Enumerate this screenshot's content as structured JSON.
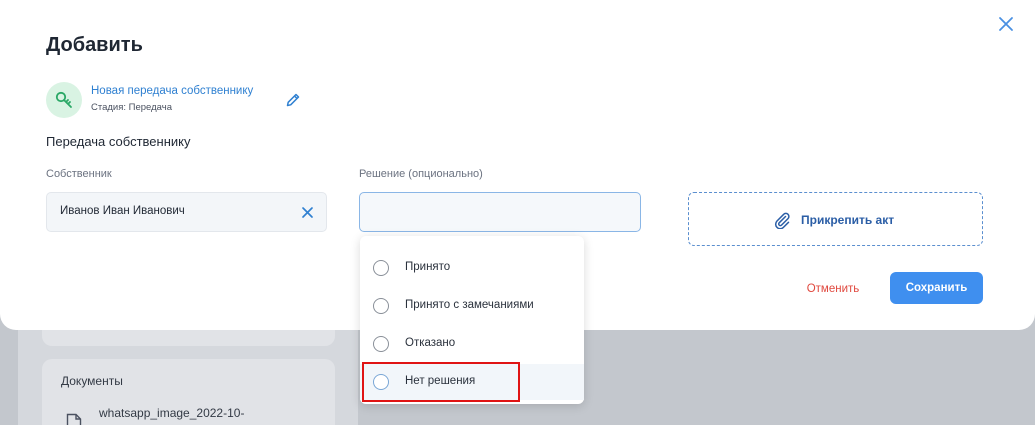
{
  "background": {
    "documents_title": "Документы",
    "file_name": "whatsapp_image_2022-10-"
  },
  "modal": {
    "title": "Добавить",
    "stage": {
      "name": "Новая передача собственнику",
      "subtitle": "Стадия: Передача",
      "icon": "key-icon"
    },
    "section_title": "Передача собственнику",
    "owner": {
      "label": "Собственник",
      "value": "Иванов Иван Иванович"
    },
    "decision": {
      "label": "Решение (опционально)",
      "value": "",
      "options": [
        "Принято",
        "Принято с замечаниями",
        "Отказано",
        "Нет решения"
      ],
      "hovered_option": "Нет решения"
    },
    "attach_label": "Прикрепить акт",
    "cancel_label": "Отменить",
    "save_label": "Сохранить"
  },
  "colors": {
    "accent": "#3f8fef",
    "link": "#2f80d1",
    "danger": "#e0483e",
    "highlight": "#e01414"
  }
}
